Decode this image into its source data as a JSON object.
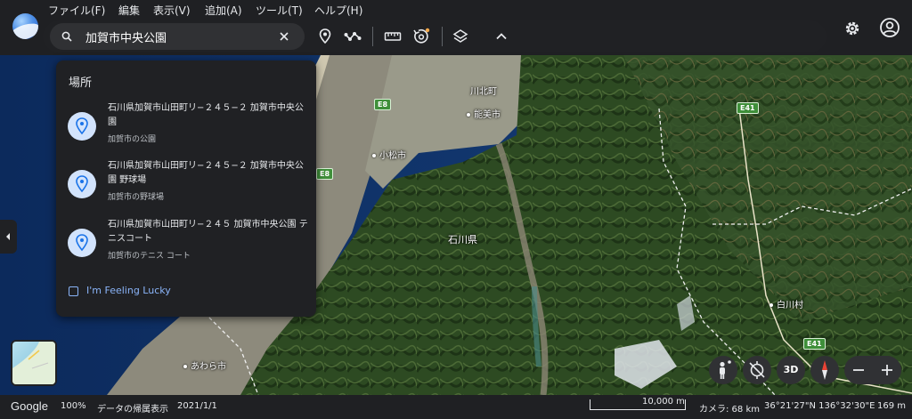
{
  "menubar": {
    "items": [
      "ファイル(F)",
      "編集",
      "表示(V)",
      "追加(A)",
      "ツール(T)",
      "ヘルプ(H)"
    ]
  },
  "search": {
    "value": "加賀市中央公園",
    "icon": "search-icon"
  },
  "toolbar": {
    "tools": [
      "place-pin-icon",
      "path-icon",
      "ruler-icon",
      "timelapse-icon",
      "layers-icon",
      "chevron-up-icon"
    ],
    "right": [
      "gear-icon",
      "account-icon"
    ]
  },
  "dropdown": {
    "heading": "場所",
    "results": [
      {
        "title": "石川県加賀市山田町リ−２４５−２ 加賀市中央公園",
        "subtitle": "加賀市の公園"
      },
      {
        "title": "石川県加賀市山田町リ−２４５−２ 加賀市中央公園 野球場",
        "subtitle": "加賀市の野球場"
      },
      {
        "title": "石川県加賀市山田町リ−２４５ 加賀市中央公園 テニスコート",
        "subtitle": "加賀市のテニス コート"
      }
    ],
    "lucky_label": "I'm Feeling Lucky"
  },
  "map": {
    "places": {
      "kawakita": "川北町",
      "nomi": "能美市",
      "komatsu": "小松市",
      "ishikawa": "石川県",
      "shirakawa": "白川村",
      "awara": "あわら市"
    },
    "shields": {
      "e8a": "E8",
      "e8b": "E8",
      "e41a": "E41",
      "e41b": "E41"
    }
  },
  "controls": {
    "three_d_label": "3D"
  },
  "status": {
    "google": "Google",
    "zoom": "100%",
    "attribution": "データの帰属表示",
    "imagery_date": "2021/1/1",
    "scale": "10,000 m",
    "camera": "カメラ: 68 km",
    "coordinates": "36°21'27\"N 136°32'30\"E",
    "elevation": "169 m"
  }
}
